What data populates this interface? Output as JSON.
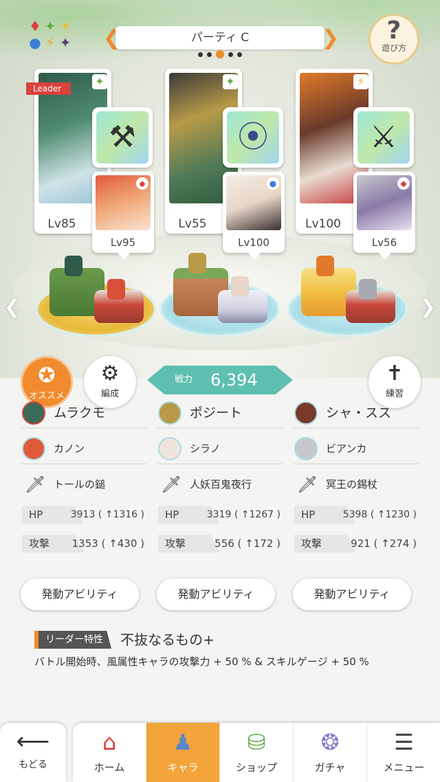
{
  "header": {
    "party_title": "パーティ C",
    "help_label": "遊び方",
    "elements": [
      "♦",
      "✦",
      "✦",
      "●",
      "⚡",
      "✦"
    ]
  },
  "party": [
    {
      "leader_label": "Leader",
      "main_level": "Lv85",
      "main_element": "✦",
      "sub_level": "Lv95",
      "sub_element": "◆",
      "weapon_icon": "⚒"
    },
    {
      "main_level": "Lv55",
      "main_element": "✦",
      "sub_level": "Lv100",
      "sub_element": "●",
      "weapon_icon": "⦿"
    },
    {
      "main_level": "Lv100",
      "main_element": "⚡",
      "sub_level": "Lv56",
      "sub_element": "◆",
      "weapon_icon": "⚔"
    }
  ],
  "actions": {
    "osusume": "オススメ",
    "hensei": "編成",
    "renshu": "練習",
    "power_label": "戦力",
    "power_value": "6,394"
  },
  "details": [
    {
      "main_name": "ムラクモ",
      "sub_name": "カノン",
      "weapon_name": "トールの鎚",
      "hp_label": "HP",
      "hp_value": "3913 ( ↑1316 )",
      "atk_label": "攻撃",
      "atk_value": "1353 ( ↑430 )",
      "ability_label": "発動アビリティ"
    },
    {
      "main_name": "ポジート",
      "sub_name": "シラノ",
      "weapon_name": "人妖百鬼夜行",
      "hp_label": "HP",
      "hp_value": "3319 ( ↑1267 )",
      "atk_label": "攻撃",
      "atk_value": "556 ( ↑172 )",
      "ability_label": "発動アビリティ"
    },
    {
      "main_name": "シャ・スス",
      "sub_name": "ビアンカ",
      "weapon_name": "冥王の錫杖",
      "hp_label": "HP",
      "hp_value": "5398 ( ↑1230 )",
      "atk_label": "攻撃",
      "atk_value": "921 ( ↑274 )",
      "ability_label": "発動アビリティ"
    }
  ],
  "leader_trait": {
    "tag": "リーダー特性",
    "name": "不抜なるもの+",
    "description": "バトル開始時、風属性キャラの攻撃力 + 50 % & スキルゲージ + 50 %"
  },
  "nav": {
    "back": "もどる",
    "tabs": [
      "ホーム",
      "キャラ",
      "ショップ",
      "ガチャ",
      "メニュー"
    ],
    "active_tab": "キャラ"
  },
  "colors": {
    "accent_orange": "#f08b2e",
    "power_teal": "#5fbfb0",
    "leader_red": "#d8413d",
    "active_tab": "#f3a43a"
  }
}
